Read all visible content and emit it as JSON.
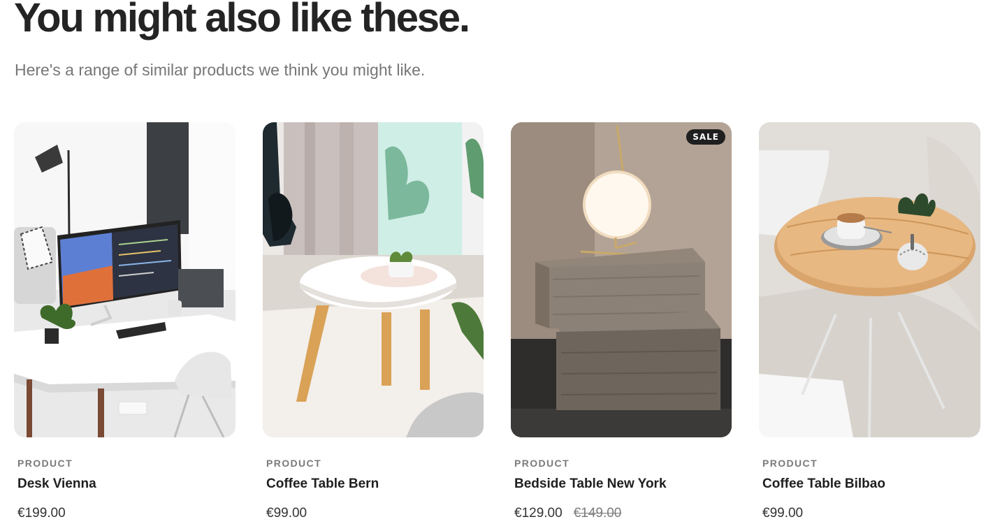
{
  "section": {
    "title": "You might also like these.",
    "subtitle": "Here's a range of similar products we think you might like."
  },
  "products": [
    {
      "category": "PRODUCT",
      "name": "Desk Vienna",
      "price": "€199.00",
      "old_price": "",
      "badge": ""
    },
    {
      "category": "PRODUCT",
      "name": "Coffee Table Bern",
      "price": "€99.00",
      "old_price": "",
      "badge": ""
    },
    {
      "category": "PRODUCT",
      "name": "Bedside Table New York",
      "price": "€129.00",
      "old_price": "€149.00",
      "badge": "SALE"
    },
    {
      "category": "PRODUCT",
      "name": "Coffee Table Bilbao",
      "price": "€99.00",
      "old_price": "",
      "badge": ""
    }
  ],
  "colors": {
    "title": "#242424",
    "subtitle": "#767676",
    "badge_bg": "#1f1f1f",
    "badge_text": "#ffffff"
  }
}
